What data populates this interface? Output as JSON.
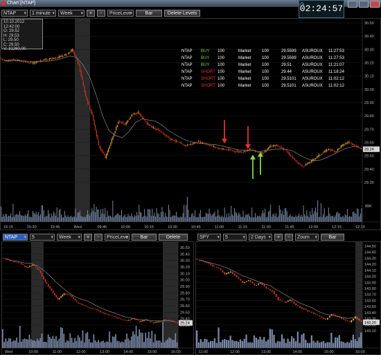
{
  "window": {
    "title": "Chart [NTAP]",
    "clock": "02:24:57"
  },
  "colors": {
    "up": "#e8a02a",
    "down": "#c8341c",
    "ma": "#8a8a8a",
    "volume": "#7a8aa8",
    "buy": "#7fd84a",
    "short": "#e0342c",
    "highlight": "#2a2a2a"
  },
  "main": {
    "symbol": "NTAP",
    "interval": "1 minute",
    "range": "Week",
    "plus": "+",
    "minus": "-",
    "indicator": "PriceLeve",
    "chart_style": "Bar",
    "delete_levels": "Delete Levels",
    "info_box": [
      "10.10.2012 12:42:00",
      "O: 29.52",
      "H: 29.53",
      "L: 29.50",
      "C: 29.50",
      "V: 31280.00"
    ],
    "price_labels": [
      "30.50",
      "30.40",
      "30.30",
      "30.20",
      "30.10",
      "30.00",
      "29.90",
      "29.80",
      "29.70",
      "29.60",
      "29.50",
      "29.40",
      "29.30"
    ],
    "last_price": "29.24",
    "volume_label": "89K",
    "time_labels": [
      "15:15",
      "15:30",
      "15:45",
      "Wed",
      "09:45",
      "10:00",
      "10:15",
      "10:30",
      "10:45",
      "11:00",
      "11:15",
      "11:30",
      "11:45",
      "12:00",
      "12:15",
      "12:30"
    ],
    "trades": [
      {
        "sym": "NTAP",
        "side": "BUY",
        "qty": "100",
        "type": "Market",
        "qty2": "100",
        "price": "29.5599",
        "route": "ASUROUX",
        "time": "11:27:53"
      },
      {
        "sym": "NTAP",
        "side": "BUY",
        "qty": "100",
        "type": "Market",
        "qty2": "100",
        "price": "29.5599",
        "route": "ASUROUX",
        "time": "11:27:53"
      },
      {
        "sym": "NTAP",
        "side": "BUY",
        "qty": "100",
        "type": "Market",
        "qty2": "100",
        "price": "29.51",
        "route": "ASUROUX",
        "time": "11:21:07"
      },
      {
        "sym": "NTAP",
        "side": "SHORT",
        "qty": "100",
        "type": "Market",
        "qty2": "100",
        "price": "29.44",
        "route": "ASUROUX",
        "time": "11:18:24"
      },
      {
        "sym": "NTAP",
        "side": "SHORT",
        "qty": "100",
        "type": "Market",
        "qty2": "100",
        "price": "29.5101",
        "route": "ASUROUX",
        "time": "11:02:12"
      },
      {
        "sym": "NTAP",
        "side": "SHORT",
        "qty": "100",
        "type": "Market",
        "qty2": "100",
        "price": "29.5101",
        "route": "ASUROUX",
        "time": "11:02:12"
      }
    ]
  },
  "left": {
    "symbol": "NTAP",
    "interval": "5 minutes",
    "range": "Week",
    "plus": "+",
    "minus": "-",
    "indicator": "PriceLeve",
    "chart_style": "Bar",
    "delete_levels": "Delete Levels",
    "price_labels": [
      "30.50",
      "30.40",
      "30.30",
      "30.20",
      "30.10",
      "30.00",
      "29.90",
      "29.80",
      "29.70",
      "29.60",
      "29.50",
      "29.40",
      "29.30"
    ],
    "last_price": "29.24",
    "time_labels": [
      "Wed",
      "10:00",
      "11:00",
      "12:00",
      "13:00",
      "14:00",
      "15:00",
      "16:00"
    ]
  },
  "right": {
    "symbol": "SPY",
    "interval": "5 minutes",
    "range": "2 Days",
    "plus": "+",
    "minus": "-",
    "zoom": "Zoom",
    "chart_style": "Bar",
    "price_labels": [
      "144.50",
      "144.40",
      "144.30",
      "144.20",
      "144.10",
      "144.00",
      "143.90",
      "143.80",
      "143.70",
      "143.60",
      "143.50",
      "143.40",
      "143.30",
      "143.20",
      "143.10"
    ],
    "last_price": "143.20",
    "time_labels": [
      "11:00",
      "12:00",
      "13:00",
      "14:00",
      "15:00",
      "16:00"
    ]
  },
  "chart_data": [
    {
      "type": "candlestick",
      "symbol": "NTAP",
      "interval": "1 minute",
      "ylim": [
        29.25,
        30.55
      ],
      "closes": [
        30.24,
        30.25,
        30.24,
        30.23,
        30.22,
        30.24,
        30.25,
        30.26,
        30.27,
        30.29,
        30.33,
        30.2,
        29.95,
        29.8,
        29.55,
        29.45,
        29.6,
        29.75,
        29.72,
        29.8,
        29.82,
        29.75,
        29.7,
        29.68,
        29.64,
        29.6,
        29.58,
        29.55,
        29.56,
        29.58,
        29.57,
        29.55,
        29.53,
        29.52,
        29.51,
        29.5,
        29.5,
        29.52,
        29.5,
        29.49,
        29.54,
        29.55,
        29.53,
        29.48,
        29.42,
        29.38,
        29.41,
        29.45,
        29.49,
        29.52,
        29.5,
        29.55,
        29.58,
        29.55,
        29.52
      ]
    },
    {
      "type": "candlestick",
      "symbol": "NTAP",
      "interval": "5 minutes",
      "ylim": [
        29.2,
        30.55
      ],
      "closes": [
        30.35,
        30.3,
        30.28,
        30.2,
        30.25,
        30.15,
        29.95,
        29.8,
        29.65,
        29.75,
        29.72,
        29.6,
        29.55,
        29.5,
        29.48,
        29.42,
        29.38,
        29.35,
        29.3,
        29.28,
        29.32,
        29.26,
        29.3,
        29.24,
        29.26,
        29.3,
        29.28,
        29.24
      ]
    },
    {
      "type": "candlestick",
      "symbol": "SPY",
      "interval": "5 minutes",
      "ylim": [
        143.05,
        144.55
      ],
      "closes": [
        144.3,
        144.25,
        144.2,
        144.15,
        144.05,
        144.1,
        144.0,
        143.9,
        143.95,
        143.85,
        143.9,
        143.8,
        143.75,
        143.6,
        143.55,
        143.6,
        143.5,
        143.45,
        143.4,
        143.35,
        143.3,
        143.25,
        143.35,
        143.3,
        143.25,
        143.2,
        143.3,
        143.2
      ]
    }
  ]
}
